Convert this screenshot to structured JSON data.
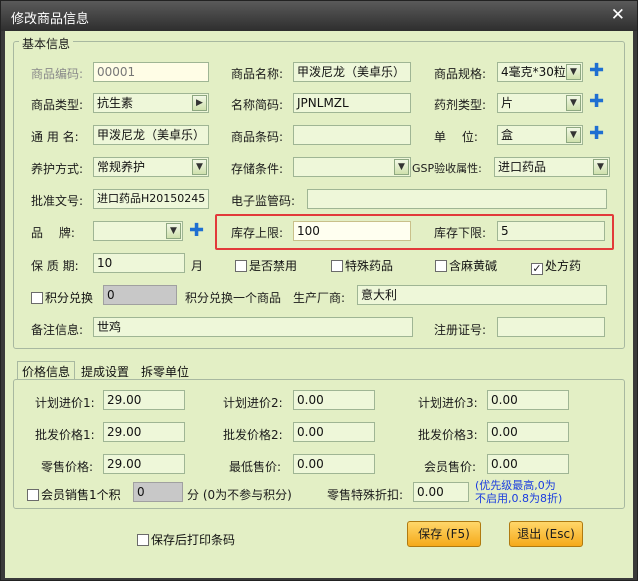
{
  "window": {
    "title": "修改商品信息",
    "close_glyph": "✕"
  },
  "basic": {
    "legend": "基本信息",
    "code": {
      "label": "商品编码:",
      "value": "00001"
    },
    "name": {
      "label": "商品名称:",
      "value": "甲泼尼龙（美卓乐）"
    },
    "spec": {
      "label": "商品规格:",
      "value": "4毫克*30粒"
    },
    "type": {
      "label": "商品类型:",
      "value": "抗生素"
    },
    "short": {
      "label": "名称简码:",
      "value": "JPNLMZL"
    },
    "dosage": {
      "label": "药剂类型:",
      "value": "片"
    },
    "common": {
      "label": "通 用 名:",
      "value": "甲泼尼龙（美卓乐）"
    },
    "barcode": {
      "label": "商品条码:",
      "value": ""
    },
    "unit": {
      "label": "单　 位:",
      "value": "盒"
    },
    "care": {
      "label": "养护方式:",
      "value": "常规养护"
    },
    "storage": {
      "label": "存储条件:",
      "value": ""
    },
    "gsp": {
      "label": "GSP验收属性:",
      "value": "进口药品"
    },
    "approval": {
      "label": "批准文号:",
      "value": "进口药品H20150245"
    },
    "supervise": {
      "label": "电子监管码:",
      "value": ""
    },
    "brand": {
      "label": "品　 牌:",
      "value": ""
    },
    "stock_upper": {
      "label": "库存上限:",
      "value": "100"
    },
    "stock_lower": {
      "label": "库存下限:",
      "value": "5"
    },
    "shelf": {
      "label": "保 质 期:",
      "value": "10",
      "unit": "月"
    },
    "chk_banned": {
      "label": "是否禁用",
      "checked": false
    },
    "chk_special": {
      "label": "特殊药品",
      "checked": false
    },
    "chk_ephedrine": {
      "label": "含麻黄碱",
      "checked": false
    },
    "chk_rx": {
      "label": "处方药",
      "checked": true
    },
    "points": {
      "label": "积分兑换",
      "value": "0",
      "suffix": "积分兑换一个商品"
    },
    "maker": {
      "label": "生产厂商:",
      "value": "意大利"
    },
    "remark": {
      "label": "备注信息:",
      "value": "世鸡"
    },
    "reg": {
      "label": "注册证号:",
      "value": ""
    }
  },
  "tabs": [
    "价格信息",
    "提成设置",
    "拆零单位"
  ],
  "price": {
    "plan1": {
      "label": "计划进价1:",
      "value": "29.00"
    },
    "plan2": {
      "label": "计划进价2:",
      "value": "0.00"
    },
    "plan3": {
      "label": "计划进价3:",
      "value": "0.00"
    },
    "whole1": {
      "label": "批发价格1:",
      "value": "29.00"
    },
    "whole2": {
      "label": "批发价格2:",
      "value": "0.00"
    },
    "whole3": {
      "label": "批发价格3:",
      "value": "0.00"
    },
    "retail": {
      "label": "零售价格:",
      "value": "29.00"
    },
    "min": {
      "label": "最低售价:",
      "value": "0.00"
    },
    "member": {
      "label": "会员售价:",
      "value": "0.00"
    },
    "member_points": {
      "label": "会员销售1个积",
      "value": "0",
      "suffix": "分 (0为不参与积分)"
    },
    "discount": {
      "label": "零售特殊折扣:",
      "value": "0.00"
    },
    "note_line1": "(优先级最高,0为",
    "note_line2": "不启用,0.8为8折)"
  },
  "footer": {
    "print_after_save": "保存后打印条码",
    "save": "保存 (F5)",
    "exit": "退出 (Esc)"
  },
  "colors": {
    "accent_plus": "#1f6fd1",
    "highlight": "#e23a3a",
    "button": "#f5a91a"
  }
}
